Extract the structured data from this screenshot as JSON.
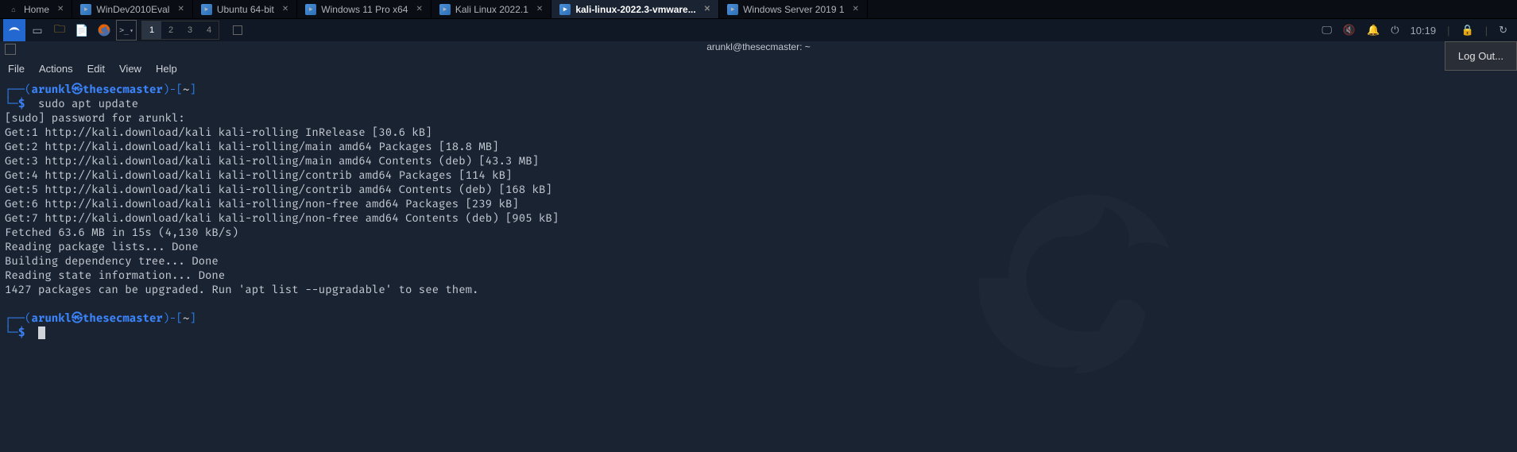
{
  "vm_tabs": [
    {
      "label": "Home",
      "type": "home"
    },
    {
      "label": "WinDev2010Eval",
      "type": "vm"
    },
    {
      "label": "Ubuntu 64-bit",
      "type": "vm"
    },
    {
      "label": "Windows 11 Pro x64",
      "type": "vm"
    },
    {
      "label": "Kali Linux 2022.1",
      "type": "vm"
    },
    {
      "label": "kali-linux-2022.3-vmware...",
      "type": "vm",
      "active": true
    },
    {
      "label": "Windows Server 2019 1",
      "type": "vm"
    }
  ],
  "kali": {
    "workspaces": [
      "1",
      "2",
      "3",
      "4"
    ],
    "active_ws": 0,
    "clock": "10:19"
  },
  "logout_label": "Log Out...",
  "term": {
    "title": "arunkl@thesecmaster: ~",
    "menu": [
      "File",
      "Actions",
      "Edit",
      "View",
      "Help"
    ],
    "prompt": {
      "user": "arunkl",
      "host": "thesecmaster",
      "path": "~",
      "dollar": "$"
    },
    "command": "sudo apt update",
    "output": [
      "[sudo] password for arunkl:",
      "Get:1 http://kali.download/kali kali-rolling InRelease [30.6 kB]",
      "Get:2 http://kali.download/kali kali-rolling/main amd64 Packages [18.8 MB]",
      "Get:3 http://kali.download/kali kali-rolling/main amd64 Contents (deb) [43.3 MB]",
      "Get:4 http://kali.download/kali kali-rolling/contrib amd64 Packages [114 kB]",
      "Get:5 http://kali.download/kali kali-rolling/contrib amd64 Contents (deb) [168 kB]",
      "Get:6 http://kali.download/kali kali-rolling/non-free amd64 Packages [239 kB]",
      "Get:7 http://kali.download/kali kali-rolling/non-free amd64 Contents (deb) [905 kB]",
      "Fetched 63.6 MB in 15s (4,130 kB/s)",
      "Reading package lists... Done",
      "Building dependency tree... Done",
      "Reading state information... Done",
      "1427 packages can be upgraded. Run 'apt list --upgradable' to see them."
    ]
  }
}
